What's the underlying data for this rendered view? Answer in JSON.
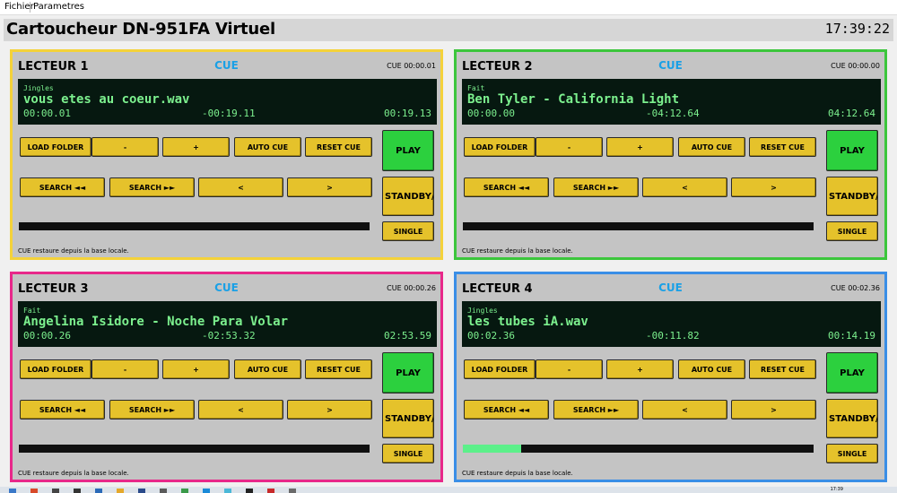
{
  "menu": {
    "items": [
      "Fichier",
      "Parametres"
    ]
  },
  "header": {
    "title": "Cartoucheur DN-951FA Virtuel",
    "clock": "17:39:22"
  },
  "deck_labels": {
    "cue": "CUE",
    "load_folder": "LOAD FOLDER",
    "minus": "-",
    "plus": "+",
    "auto_cue": "AUTO CUE",
    "reset_cue": "RESET CUE",
    "search_back": "SEARCH ◄◄",
    "search_fwd": "SEARCH ►►",
    "prev": "<",
    "next": ">",
    "play": "PLAY",
    "standby": "STANDBY/(",
    "single": "SINGLE"
  },
  "decks": [
    {
      "title": "LECTEUR 1",
      "cue_time": "CUE 00:00.01",
      "category": "Jingles",
      "track": "vous etes au coeur.wav",
      "elapsed": "00:00.01",
      "remaining": "-00:19.11",
      "total": "00:19.13",
      "progress": 0.0,
      "status": "CUE restaure depuis la base locale.",
      "border_color": "#f4d23a"
    },
    {
      "title": "LECTEUR 2",
      "cue_time": "CUE 00:00.00",
      "category": "Fait",
      "track": "Ben Tyler - California Light",
      "elapsed": "00:00.00",
      "remaining": "-04:12.64",
      "total": "04:12.64",
      "progress": 0.0,
      "status": "CUE restaure depuis la base locale.",
      "border_color": "#3cc63c"
    },
    {
      "title": "LECTEUR 3",
      "cue_time": "CUE 00:00.26",
      "category": "Fait",
      "track": "Angelina Isidore - Noche Para Volar",
      "elapsed": "00:00.26",
      "remaining": "-02:53.32",
      "total": "02:53.59",
      "progress": 0.0,
      "status": "CUE restaure depuis la base locale.",
      "border_color": "#e8288a"
    },
    {
      "title": "LECTEUR 4",
      "cue_time": "CUE 00:02.36",
      "category": "Jingles",
      "track": "les tubes iA.wav",
      "elapsed": "00:02.36",
      "remaining": "-00:11.82",
      "total": "00:14.19",
      "progress": 0.166,
      "status": "CUE restaure depuis la base locale.",
      "border_color": "#3a8ee6"
    }
  ],
  "taskbar": {
    "clock": "17:39"
  }
}
